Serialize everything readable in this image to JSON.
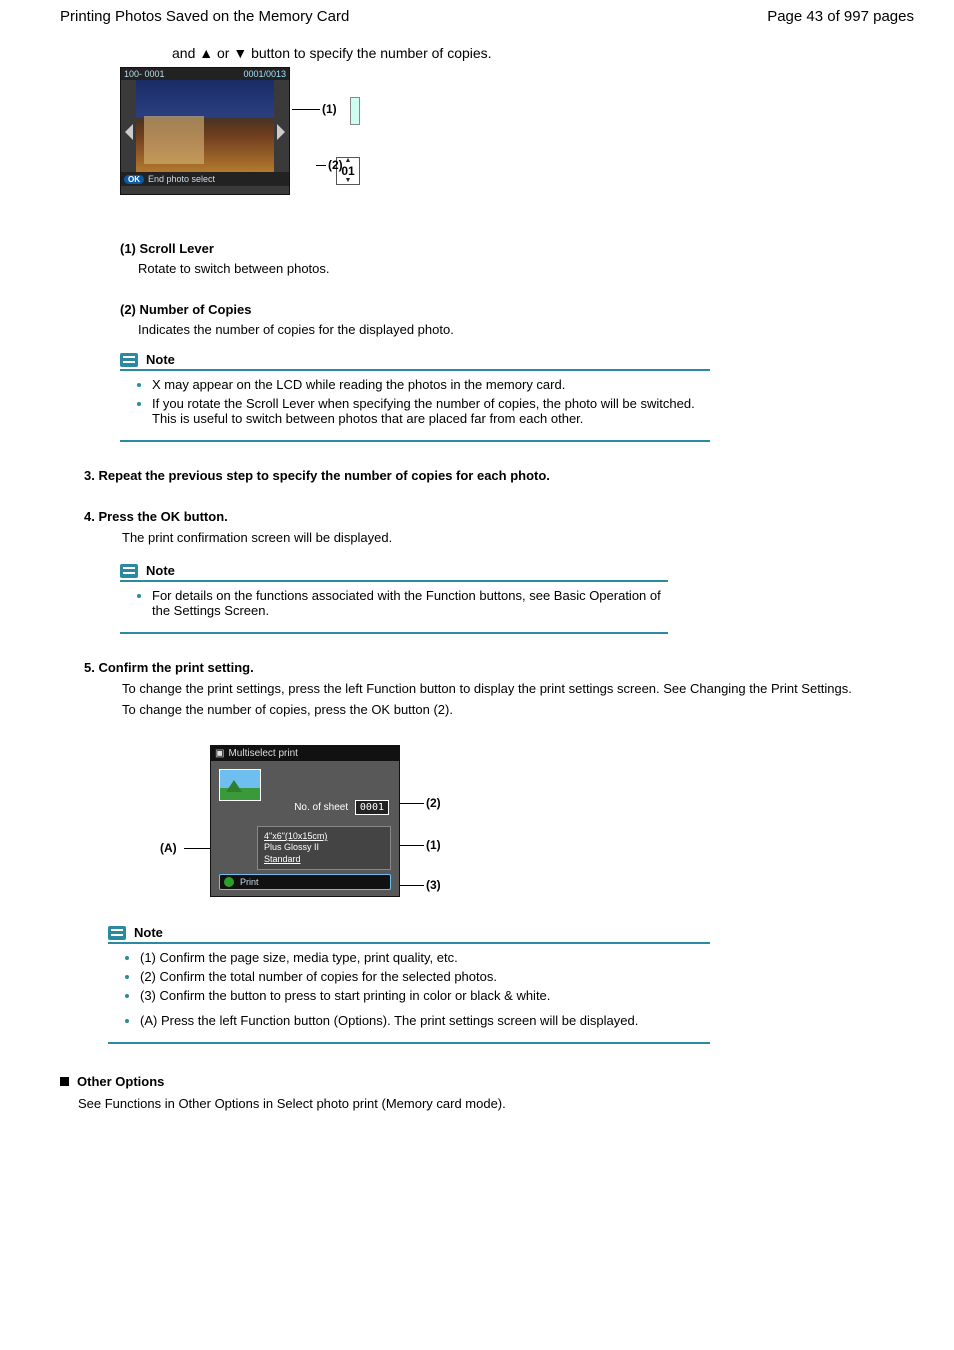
{
  "header": {
    "title": "Printing Photos Saved on the Memory Card",
    "pager": "Page 43 of 997 pages"
  },
  "arrows_text": "and ▲ or ▼ button to specify the number of copies.",
  "lcd1": {
    "top_left": "100- 0001",
    "top_right": "0001/0013",
    "copies": "01",
    "bottom_ok": "OK",
    "bottom_text": "End photo select",
    "call1": "(1)",
    "call2": "(2)"
  },
  "s1": {
    "h": "(1) Scroll Lever",
    "p": "Rotate to switch between photos."
  },
  "s2": {
    "h": "(2) Number of Copies",
    "p": "Indicates the number of copies for the displayed photo."
  },
  "note1": {
    "title": "Note",
    "bullets": [
      "X may appear on the LCD while reading the photos in the memory card.",
      "If you rotate the Scroll Lever when specifying the number of copies, the photo will be switched. This is useful to switch between photos that are placed far from each other."
    ]
  },
  "step3": {
    "title": "3. Repeat the previous step to specify the number of copies for each photo.",
    "body": ""
  },
  "step4": {
    "title": "4. Press the OK button.",
    "body": "The print confirmation screen will be displayed."
  },
  "note2": {
    "title": "Note",
    "bullets": [
      "For details on the functions associated with the Function buttons, see Basic Operation of the Settings Screen."
    ],
    "link_text": "Basic Operation of the Settings Screen"
  },
  "step5": {
    "title": "5. Confirm the print setting.",
    "p1": "To change the print settings, press the left Function button to display the print settings screen. See Changing the Print Settings.",
    "link": "Changing the Print Settings",
    "p2": "To change the number of copies, press the OK button (2)."
  },
  "lcd2": {
    "title": "Multiselect print",
    "sheets_label": "No. of sheet",
    "sheets_value": "0001",
    "line1": "4\"x6\"(10x15cm)",
    "line2": "Plus Glossy II",
    "line3": "Standard",
    "footer": "Print",
    "callA": "(A)",
    "call1": "(1)",
    "call2": "(2)",
    "call3": "(3)"
  },
  "note3": {
    "title": "Note",
    "bullets": [
      "(1) Confirm the page size, media type, print quality, etc.",
      "(2) Confirm the total number of copies for the selected photos.",
      "(3) Confirm the button to press to start printing in color or black & white.",
      "(A) Press the left Function button (Options). The print settings screen will be displayed."
    ]
  },
  "other_section": {
    "title": "Other Options",
    "body": "See Functions in Other Options in Select photo print (Memory card mode)."
  }
}
